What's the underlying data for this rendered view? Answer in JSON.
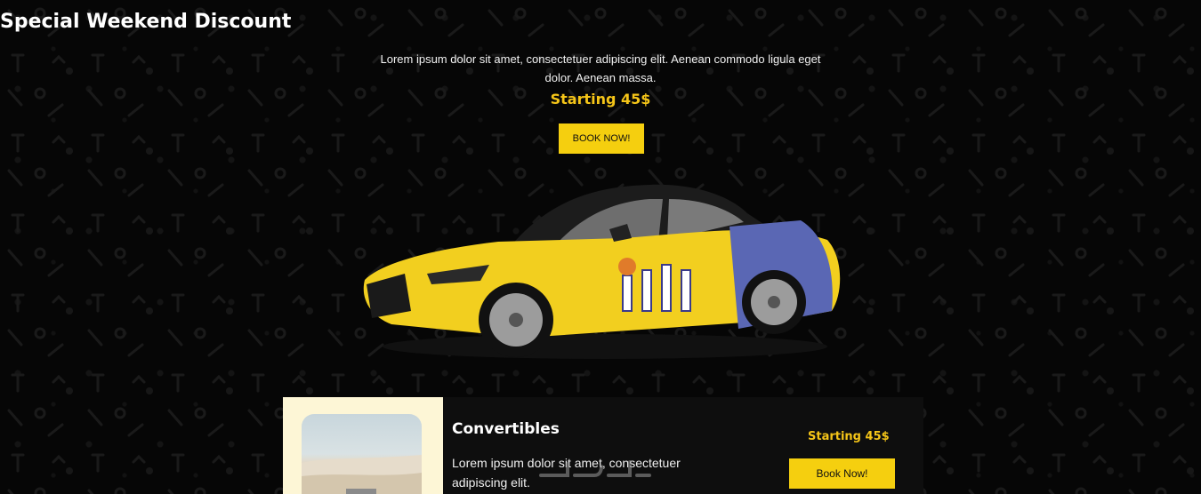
{
  "hero": {
    "title": "Special Weekend Discount",
    "description": "Lorem ipsum dolor sit amet, consectetuer adipiscing elit. Aenean commodo ligula eget dolor. Aenean massa.",
    "price": "Starting 45$",
    "button_label": "BOOK NOW!"
  },
  "service_card": {
    "title": "Convertibles",
    "description": "Lorem ipsum dolor sit amet, consectetuer adipiscing elit.",
    "price": "Starting 45$",
    "button_label": "Book Now!"
  },
  "colors": {
    "accent": "#f5cf0f",
    "background": "#060606",
    "card_light": "#fdf6d6",
    "card_dark": "#0e0e0e",
    "car_body": "#f2cf1f",
    "wrap_blue": "#5a67b4"
  }
}
